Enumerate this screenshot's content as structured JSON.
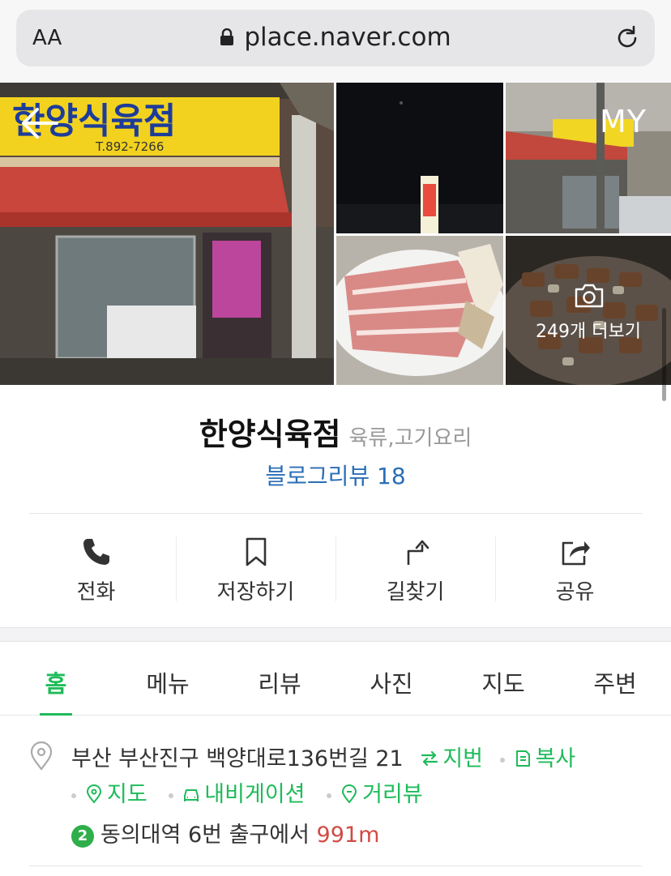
{
  "browser": {
    "text_size_label": "AA",
    "url": "place.naver.com"
  },
  "gallery": {
    "my_label": "MY",
    "more_photos_label": "249개 더보기",
    "sign_text": "한양식육점",
    "sign_phone": "T.892-7266"
  },
  "place": {
    "name": "한양식육점",
    "category": "육류,고기요리",
    "blog_review": "블로그리뷰 18"
  },
  "actions": [
    {
      "label": "전화",
      "icon": "phone-icon"
    },
    {
      "label": "저장하기",
      "icon": "bookmark-icon"
    },
    {
      "label": "길찾기",
      "icon": "directions-icon"
    },
    {
      "label": "공유",
      "icon": "share-icon"
    }
  ],
  "tabs": [
    {
      "label": "홈",
      "active": true
    },
    {
      "label": "메뉴"
    },
    {
      "label": "리뷰"
    },
    {
      "label": "사진"
    },
    {
      "label": "지도"
    },
    {
      "label": "주변"
    }
  ],
  "address": {
    "text": "부산 부산진구 백양대로136번길 21",
    "jibun_label": "지번",
    "copy_label": "복사",
    "map_label": "지도",
    "navigation_label": "내비게이션",
    "streetview_label": "거리뷰"
  },
  "subway": {
    "line_number": "2",
    "station": "동의대역",
    "exit_text": "6번 출구에서",
    "distance": "991m"
  },
  "colors": {
    "accent_green": "#1fbb5a",
    "link_blue": "#2a6eb5",
    "distance_red": "#d14a44"
  }
}
